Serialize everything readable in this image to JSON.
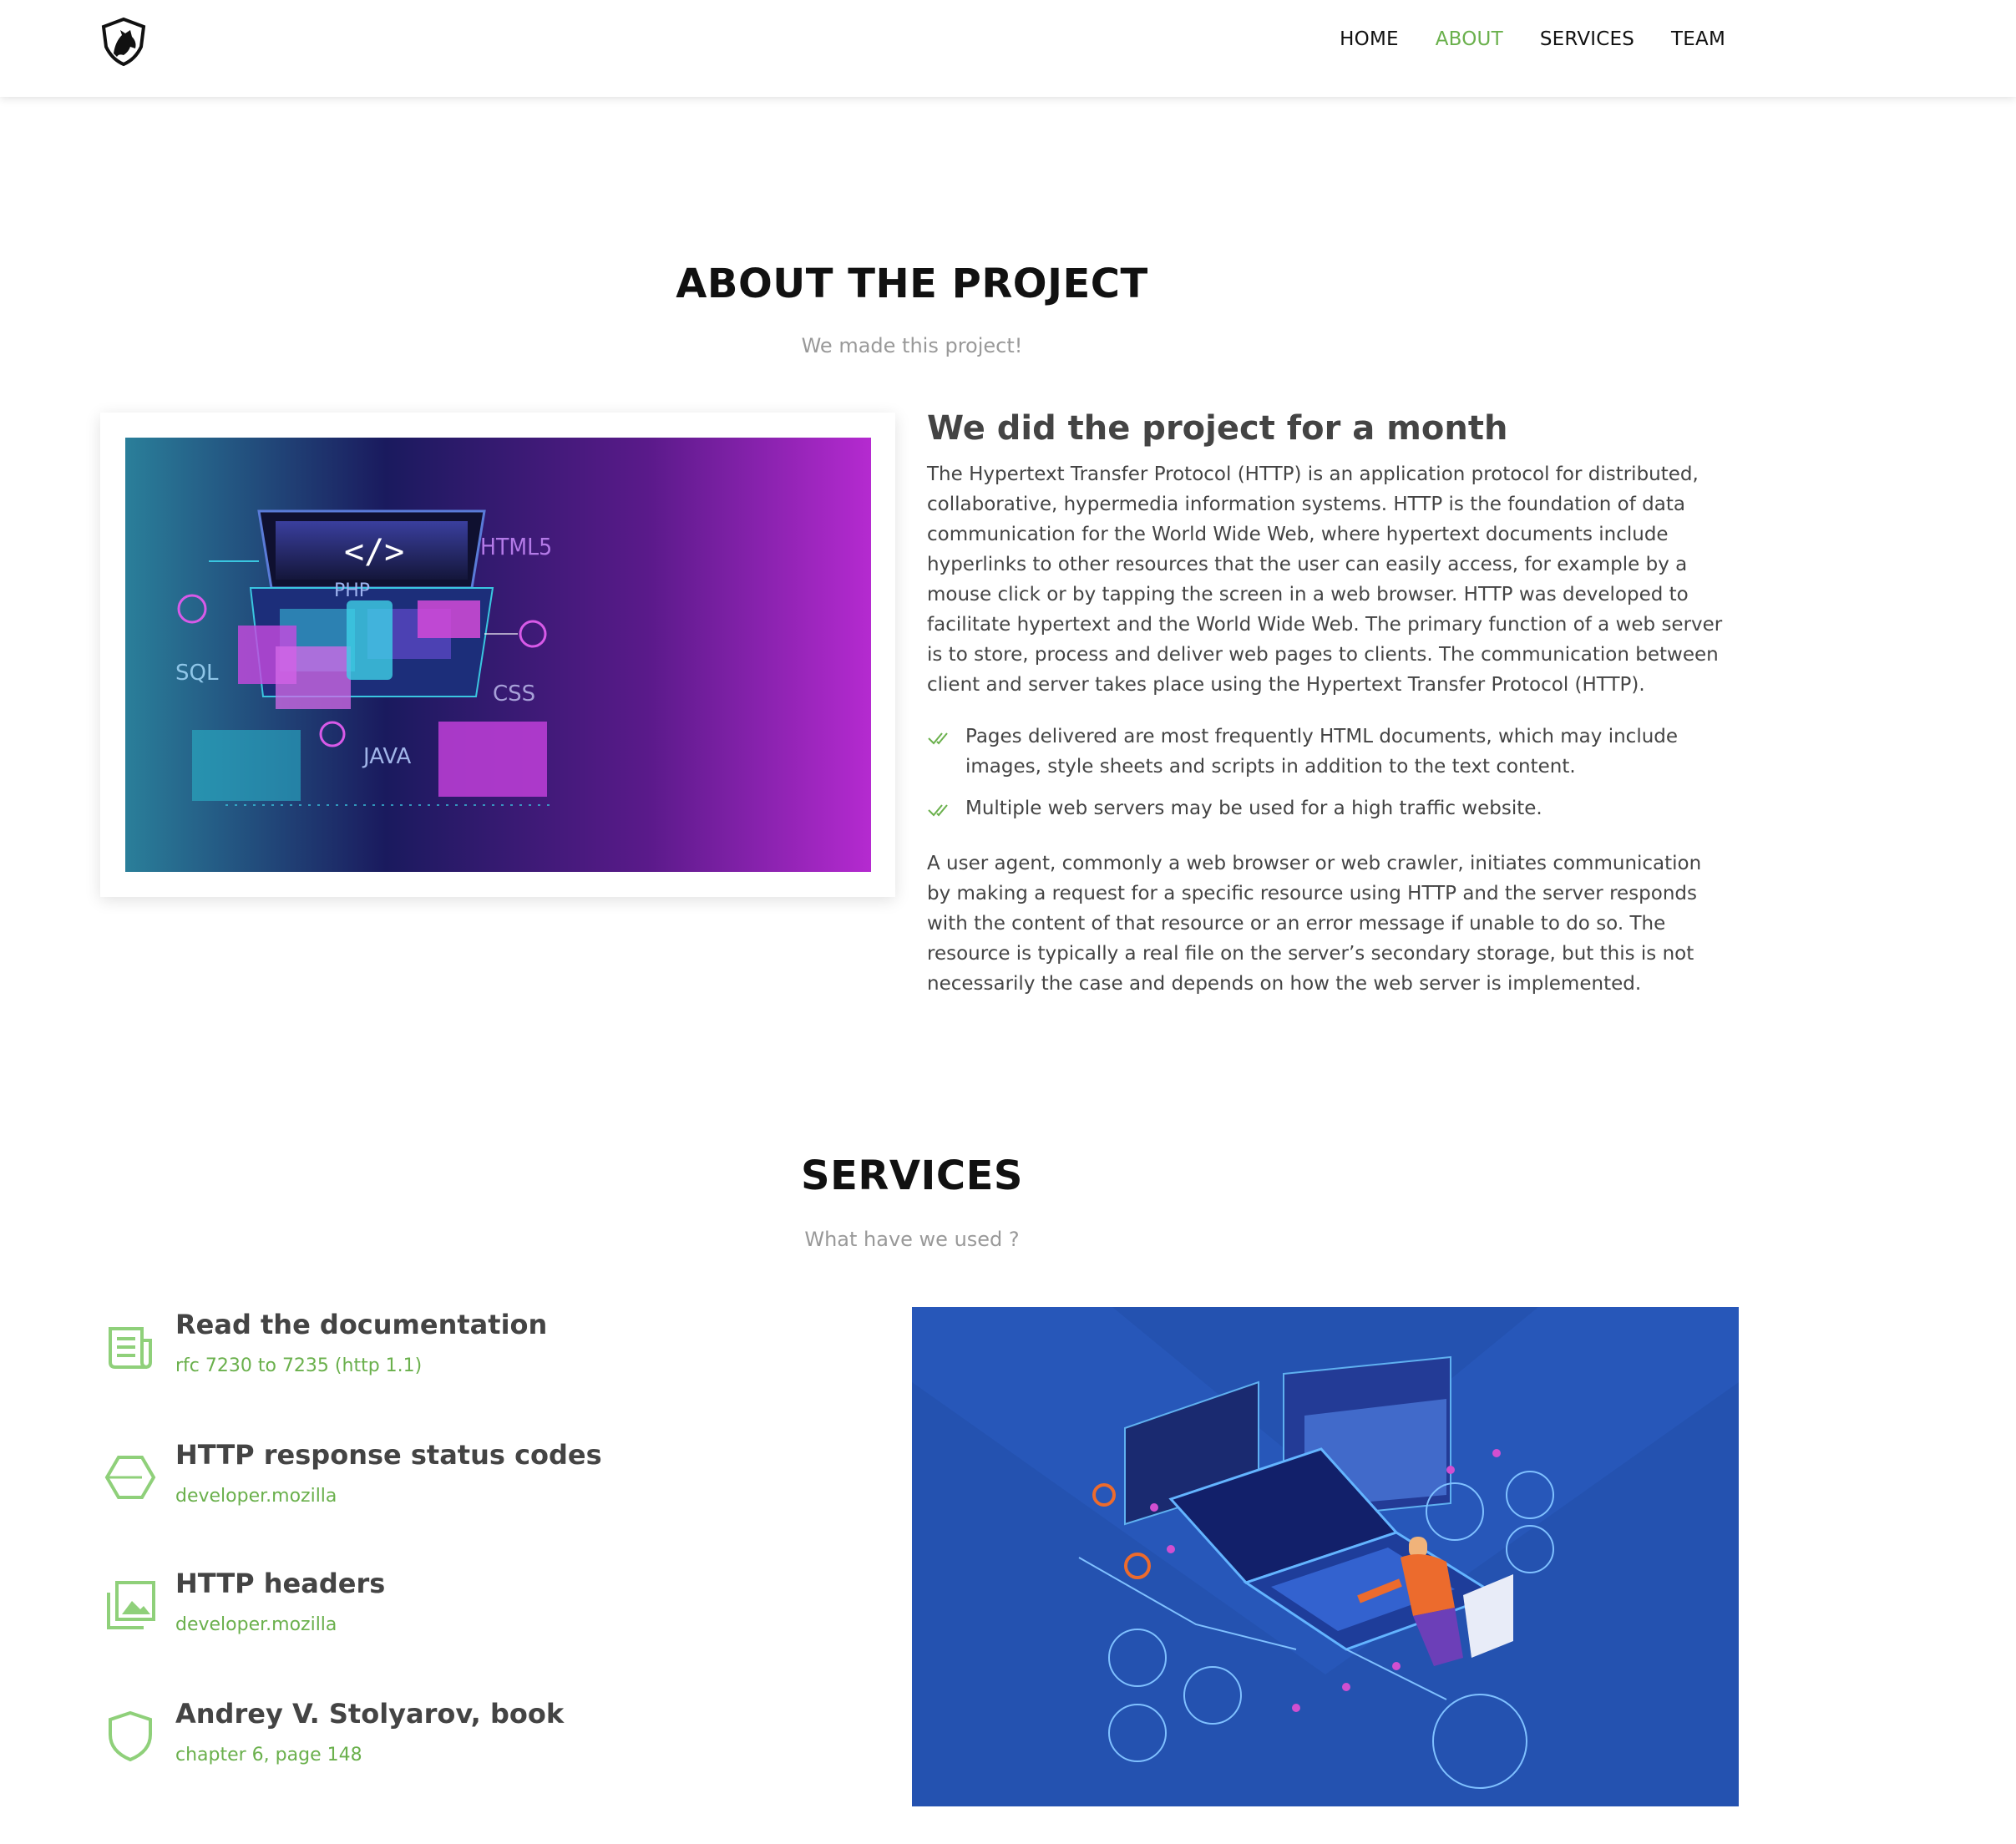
{
  "nav": {
    "items": [
      {
        "label": "HOME",
        "active": false
      },
      {
        "label": "ABOUT",
        "active": true
      },
      {
        "label": "SERVICES",
        "active": false
      },
      {
        "label": "TEAM",
        "active": false
      }
    ]
  },
  "about": {
    "title": "ABOUT THE PROJECT",
    "subtitle": "We made this project!",
    "heading": "We did the project for a month",
    "paragraph1": "The Hypertext Transfer Protocol (HTTP) is an application protocol for distributed, collaborative, hypermedia information systems. HTTP is the foundation of data communication for the World Wide Web, where hypertext documents include hyperlinks to other resources that the user can easily access, for example by a mouse click or by tapping the screen in a web browser. HTTP was developed to facilitate hypertext and the World Wide Web. The primary function of a web server is to store, process and deliver web pages to clients. The communication between client and server takes place using the Hypertext Transfer Protocol (HTTP).",
    "checks": [
      "Pages delivered are most frequently HTML documents, which may include images, style sheets and scripts in addition to the text content.",
      "Multiple web servers may be used for a high traffic website."
    ],
    "paragraph2": "A user agent, commonly a web browser or web crawler, initiates communication by making a request for a specific resource using HTTP and the server responds with the content of that resource or an error message if unable to do so. The resource is typically a real file on the server’s secondary storage, but this is not necessarily the case and depends on how the web server is implemented.",
    "image_labels": {
      "code": "</>",
      "html5": "HTML5",
      "php": "PHP",
      "sql": "SQL",
      "css": "CSS",
      "java": "JAVA"
    }
  },
  "services": {
    "title": "SERVICES",
    "subtitle": "What have we used ?",
    "items": [
      {
        "icon": "newspaper-icon",
        "title": "Read the documentation",
        "desc": "rfc 7230 to 7235 (http 1.1)"
      },
      {
        "icon": "hexagon-icon",
        "title": "HTTP response status codes",
        "desc": "developer.mozilla"
      },
      {
        "icon": "images-icon",
        "title": "HTTP headers",
        "desc": "developer.mozilla"
      },
      {
        "icon": "shield-icon",
        "title": "Andrey V. Stolyarov, book",
        "desc": "chapter 6, page 148"
      }
    ]
  },
  "colors": {
    "accent": "#6ab04c",
    "heading": "#111111",
    "text": "#444444",
    "muted": "#999999"
  }
}
